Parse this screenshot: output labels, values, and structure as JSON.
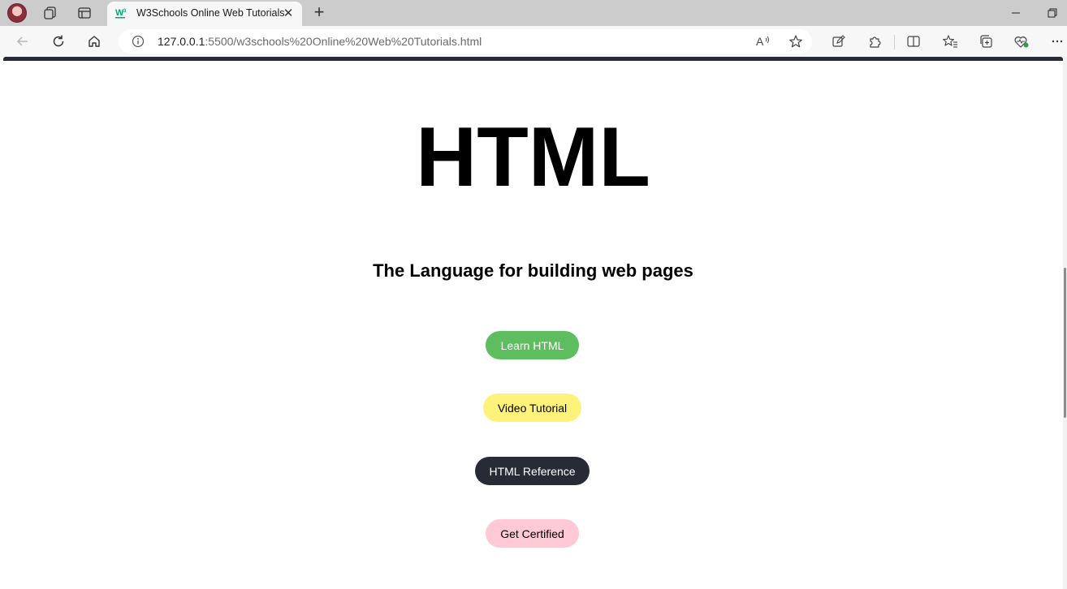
{
  "browser": {
    "tab": {
      "title": "W3Schools Online Web Tutorials"
    },
    "address": {
      "host": "127.0.0.1",
      "rest": ":5500/w3schools%20Online%20Web%20Tutorials.html"
    }
  },
  "page": {
    "title": "HTML",
    "subtitle": "The Language for building web pages",
    "buttons": [
      {
        "label": "Learn HTML",
        "color": "#5ebd5e"
      },
      {
        "label": "Video Tutorial",
        "color": "#fff27b"
      },
      {
        "label": "HTML Reference",
        "color": "#282a35"
      },
      {
        "label": "Get Certified",
        "color": "#ffc9d5"
      }
    ]
  },
  "colors": {
    "accent_dark": "#282a35",
    "w3_green": "#04aa6d"
  },
  "icons": {
    "tab_close": "✕",
    "new_tab": "+"
  }
}
